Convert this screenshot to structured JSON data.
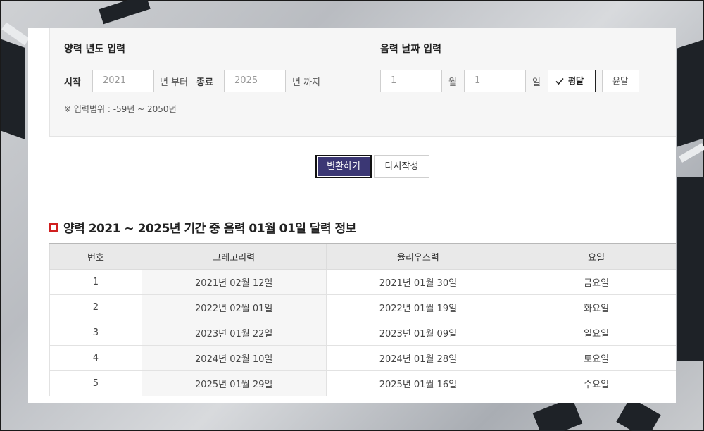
{
  "solar_year": {
    "title": "양력 년도 입력",
    "start_label": "시작",
    "start_value": "2021",
    "from_text": "년 부터",
    "end_label": "종료",
    "end_value": "2025",
    "until_text": "년 까지",
    "range_note": "※ 입력범위 : -59년 ~ 2050년"
  },
  "lunar_date": {
    "title": "음력 날짜 입력",
    "month_value": "1",
    "month_unit": "월",
    "day_value": "1",
    "day_unit": "일",
    "normal_month_label": "평달",
    "leap_month_label": "윤달"
  },
  "actions": {
    "convert_label": "변환하기",
    "reset_label": "다시작성"
  },
  "result": {
    "title": "양력 2021 ~ 2025년 기간 중 음력 01월 01일 달력 정보",
    "columns": [
      "번호",
      "그레고리력",
      "율리우스력",
      "요일"
    ],
    "rows": [
      [
        "1",
        "2021년 02월 12일",
        "2021년 01월 30일",
        "금요일"
      ],
      [
        "2",
        "2022년 02월 01일",
        "2022년 01월 19일",
        "화요일"
      ],
      [
        "3",
        "2023년 01월 22일",
        "2023년 01월 09일",
        "일요일"
      ],
      [
        "4",
        "2024년 02월 10일",
        "2024년 01월 28일",
        "토요일"
      ],
      [
        "5",
        "2025년 01월 29일",
        "2025년 01월 16일",
        "수요일"
      ]
    ]
  },
  "colors": {
    "primary_button": "#3b3774",
    "title_marker": "#d01f1f"
  }
}
